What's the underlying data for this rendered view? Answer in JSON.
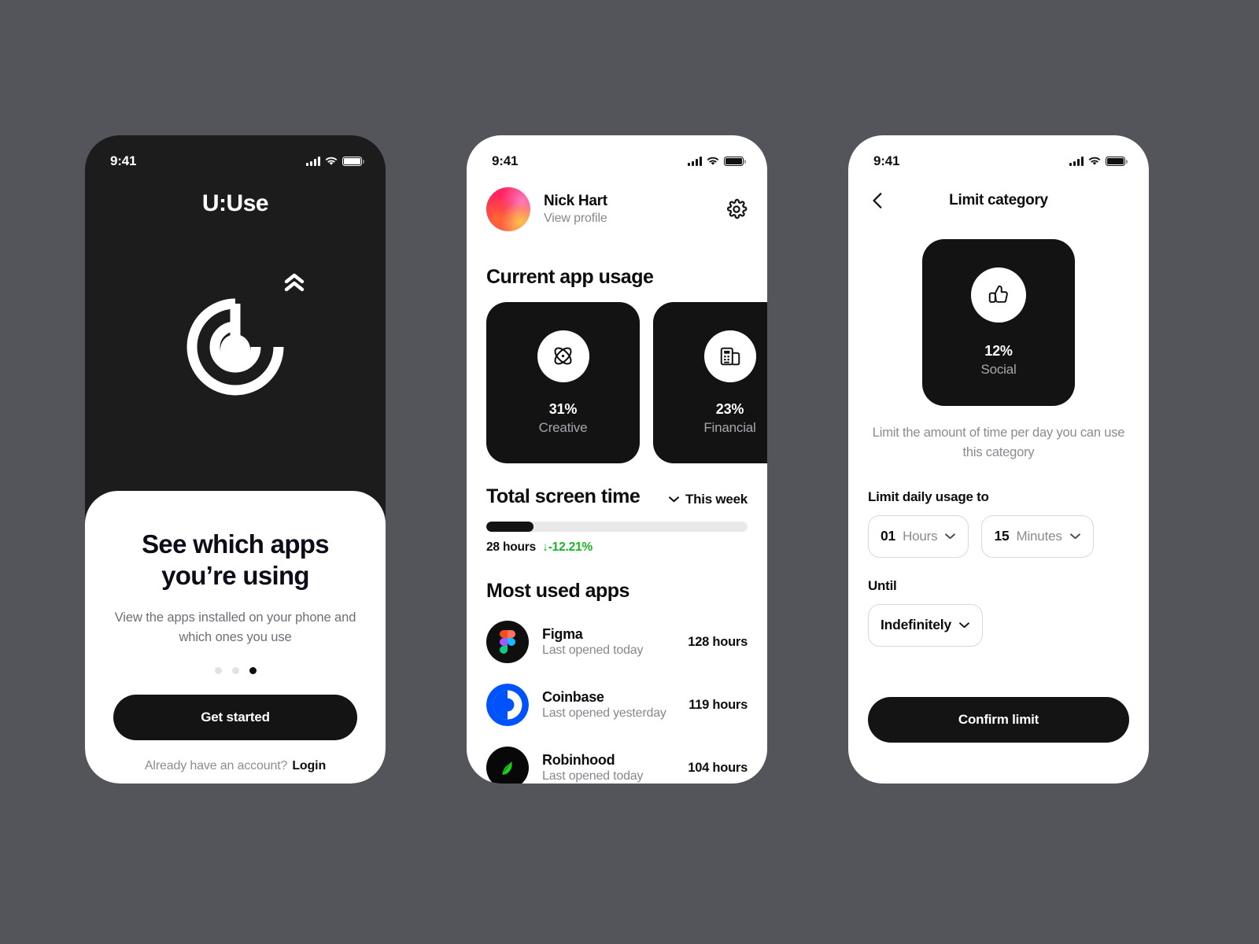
{
  "canvas": {
    "background": "#53555b"
  },
  "screens": [
    {
      "id": "onboarding",
      "statusbar": {
        "time": "9:41",
        "signal_icon": "cellular-signal-icon",
        "wifi_icon": "wifi-icon",
        "battery_icon": "battery-icon"
      },
      "app_title": "U:Use",
      "logo_icon": "radar-target-logo-icon",
      "chevron_up_icon": "double-chevron-up-icon",
      "heading": "See which apps you’re using",
      "subtext": "View the apps installed on your phone and which ones you use",
      "pager": {
        "count": 3,
        "active_index": 2
      },
      "primary_button": "Get started",
      "footer_prompt": "Already have an account?",
      "footer_link": "Login"
    },
    {
      "id": "dashboard",
      "statusbar": {
        "time": "9:41"
      },
      "profile": {
        "name": "Nick Hart",
        "subtitle": "View profile",
        "avatar_icon": "gradient-avatar",
        "settings_icon": "gear-icon"
      },
      "current_usage": {
        "heading": "Current app usage",
        "cards": [
          {
            "percent": "31%",
            "label": "Creative",
            "icon": "atom-orbit-icon"
          },
          {
            "percent": "23%",
            "label": "Financial",
            "icon": "payment-terminal-icon"
          }
        ]
      },
      "screen_time": {
        "heading": "Total screen time",
        "range_label": "This week",
        "range_icon": "chevron-down-icon",
        "progress_percent": 18,
        "total": "28 hours",
        "delta": "-12.21%",
        "delta_icon": "arrow-down-icon",
        "delta_color": "#16b524"
      },
      "most_used": {
        "heading": "Most used apps",
        "apps": [
          {
            "name": "Figma",
            "subtitle": "Last opened today",
            "hours": "128 hours",
            "icon": "figma-icon"
          },
          {
            "name": "Coinbase",
            "subtitle": "Last opened yesterday",
            "hours": "119 hours",
            "icon": "coinbase-icon"
          },
          {
            "name": "Robinhood",
            "subtitle": "Last opened today",
            "hours": "104 hours",
            "icon": "robinhood-icon"
          }
        ]
      }
    },
    {
      "id": "limit-category",
      "statusbar": {
        "time": "9:41"
      },
      "nav": {
        "back_icon": "chevron-left-icon",
        "title": "Limit category"
      },
      "category_card": {
        "percent": "12%",
        "label": "Social",
        "icon": "thumbs-up-icon"
      },
      "description": "Limit the amount of time per day you can use this category",
      "limit_label": "Limit daily usage to",
      "hours_value": "01",
      "hours_unit": "Hours",
      "minutes_value": "15",
      "minutes_unit": "Minutes",
      "until_label": "Until",
      "until_value": "Indefinitely",
      "confirm_button": "Confirm limit"
    }
  ]
}
